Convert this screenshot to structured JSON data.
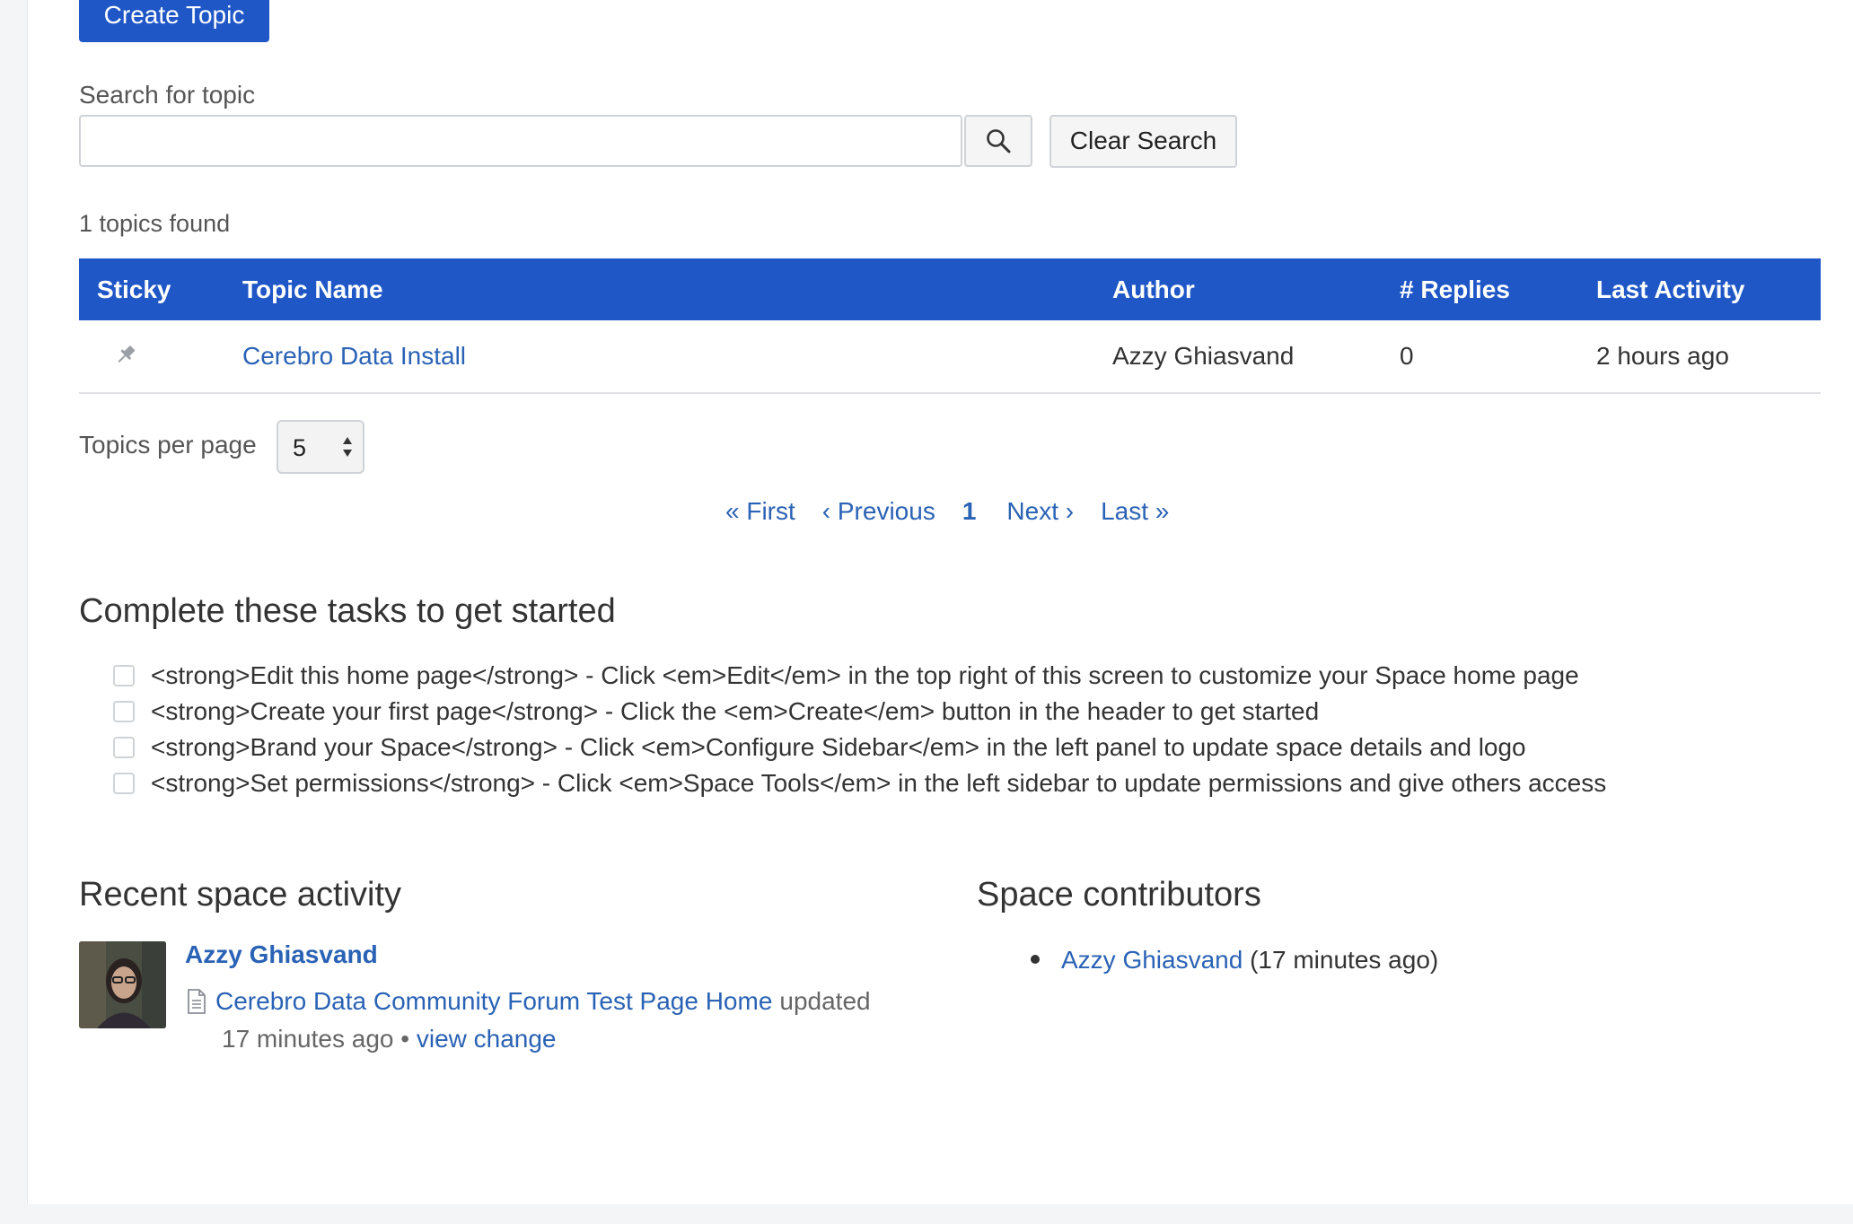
{
  "toolbar": {
    "create_label": "Create Topic"
  },
  "search": {
    "label": "Search for topic",
    "value": "",
    "placeholder": "",
    "clear_label": "Clear Search",
    "search_icon": "magnifier-icon"
  },
  "results": {
    "count_text": "1 topics found"
  },
  "table": {
    "headers": {
      "sticky": "Sticky",
      "name": "Topic Name",
      "author": "Author",
      "replies": "# Replies",
      "activity": "Last Activity"
    },
    "rows": [
      {
        "sticky_icon": "pin-icon",
        "name": "Cerebro Data Install",
        "author": "Azzy Ghiasvand",
        "replies": "0",
        "activity": "2 hours ago"
      }
    ],
    "header_color": "#1f57c7"
  },
  "pager": {
    "per_page_label": "Topics per page",
    "per_page_value": "5",
    "first": "« First",
    "previous": "‹ Previous",
    "current": "1",
    "next": "Next ›",
    "last": "Last »"
  },
  "tasks": {
    "heading": "Complete these tasks to get started",
    "items": [
      "<strong>Edit this home page</strong> - Click <em>Edit</em> in the top right of this screen to customize your Space home page",
      "<strong>Create your first page</strong> - Click the <em>Create</em> button in the header to get started",
      "<strong>Brand your Space</strong> - Click <em>Configure Sidebar</em> in the left panel to update space details and logo",
      "<strong>Set permissions</strong> - Click <em>Space Tools</em> in the left sidebar to update permissions and give others access"
    ]
  },
  "recent": {
    "heading": "Recent space activity",
    "user": "Azzy Ghiasvand",
    "page_title": "Cerebro Data Community Forum Test Page Home",
    "action": "updated",
    "time": "17 minutes ago",
    "separator": "•",
    "view_change": "view change"
  },
  "contributors": {
    "heading": "Space contributors",
    "items": [
      {
        "name": "Azzy Ghiasvand",
        "when": "(17 minutes ago)"
      }
    ]
  },
  "colors": {
    "accent": "#1f57c7",
    "link": "#2a62b5"
  }
}
